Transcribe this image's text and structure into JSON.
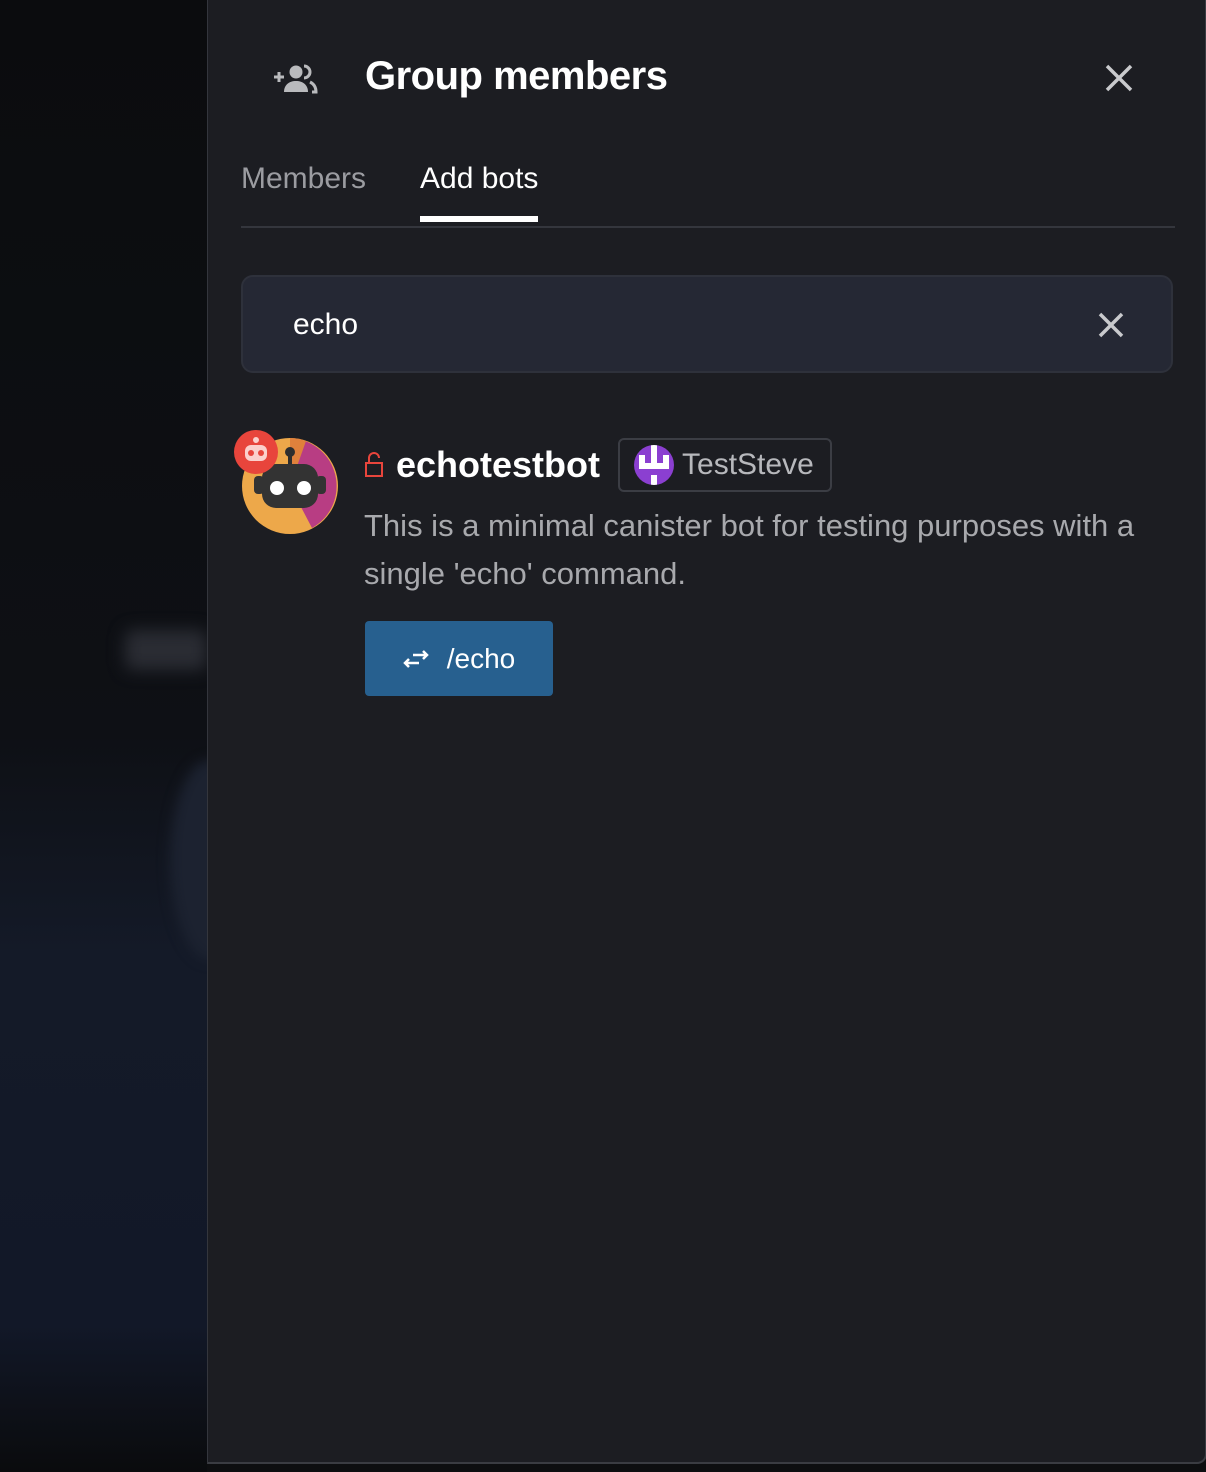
{
  "panel": {
    "title": "Group members",
    "header_icon": "add-group-icon",
    "close_icon": "close-icon"
  },
  "tabs": [
    {
      "label": "Members",
      "active": false
    },
    {
      "label": "Add bots",
      "active": true
    }
  ],
  "search": {
    "value": "echo",
    "clear_icon": "close-icon"
  },
  "results": [
    {
      "name": "echotestbot",
      "locked_icon": "unlock-icon",
      "owner": "TestSteve",
      "description": "This is a minimal canister bot for testing purposes with a single 'echo' command.",
      "commands": [
        {
          "label": "/echo",
          "icon": "swap-arrows-icon"
        }
      ]
    }
  ],
  "colors": {
    "panel_bg": "#1c1d22",
    "command_button": "#27608f",
    "lock": "#e8453c",
    "bot_badge": "#e8453c"
  }
}
